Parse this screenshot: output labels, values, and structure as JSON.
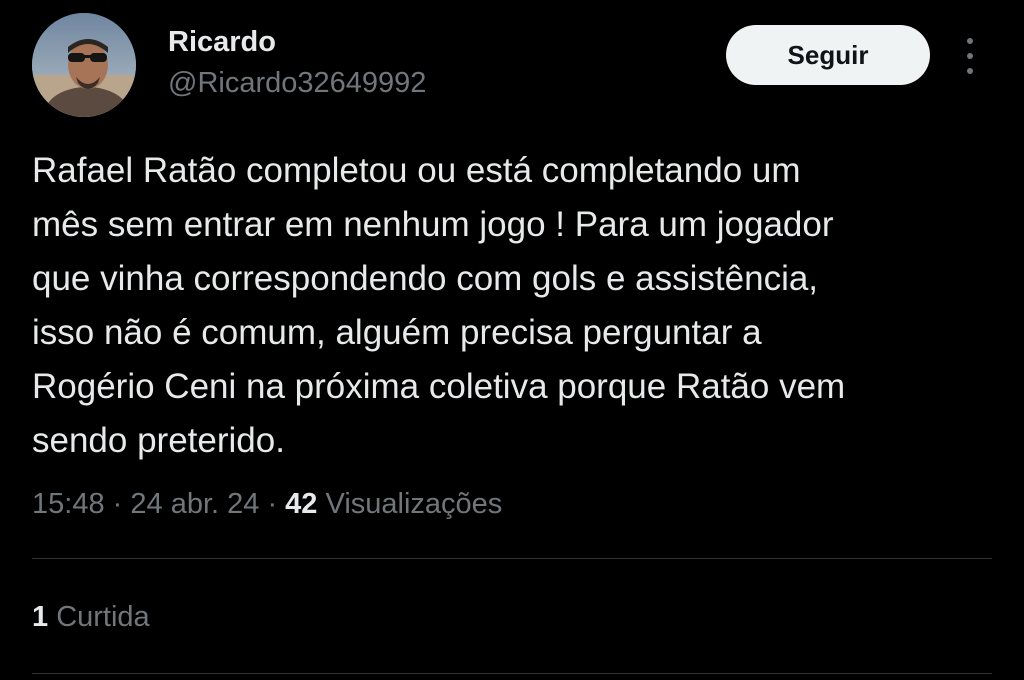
{
  "author": {
    "name": "Ricardo",
    "handle": "@Ricardo32649992"
  },
  "follow_button": {
    "label": "Seguir"
  },
  "tweet": {
    "lines": [
      "Rafael Ratão completou ou está completando um",
      "mês sem entrar em nenhum jogo ! Para um jogador",
      "que vinha correspondendo com gols e assistência,",
      "isso não é comum, alguém precisa perguntar a",
      "Rogério Ceni na próxima coletiva porque Ratão vem",
      "sendo preterido."
    ]
  },
  "meta": {
    "time": "15:48",
    "separator": "·",
    "date": "24 abr. 24",
    "views_count": "42",
    "views_label": "Visualizações"
  },
  "engagement": {
    "likes_count": "1",
    "likes_label": "Curtida"
  },
  "colors": {
    "background": "#000000",
    "primary_text": "#e7e9ea",
    "secondary_text": "#71767b",
    "divider": "#2f3336",
    "button_bg": "#eff3f4",
    "button_text": "#0f1419"
  },
  "icons": {
    "more": "more-vertical-icon",
    "avatar": "user-avatar-photo"
  }
}
